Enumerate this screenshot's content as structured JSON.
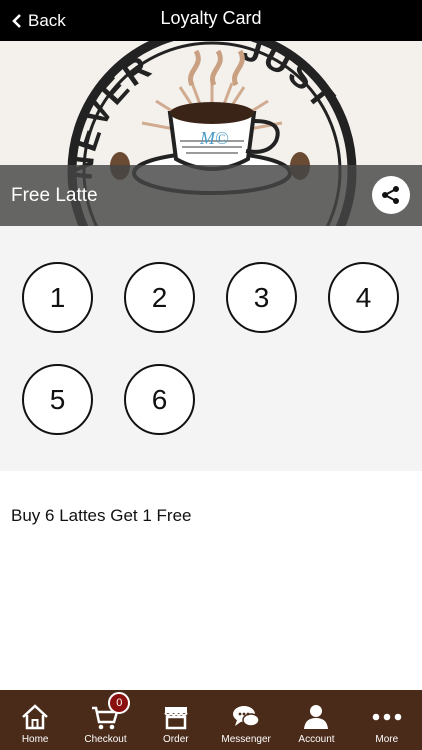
{
  "header": {
    "back_label": "Back",
    "title": "Loyalty Card"
  },
  "hero": {
    "logo_text_left": "NEVER",
    "logo_text_right": "JUST",
    "cup_mark": "M©"
  },
  "card": {
    "name": "Free Latte",
    "description": "Buy 6 Lattes Get 1 Free"
  },
  "stamps": [
    "1",
    "2",
    "3",
    "4",
    "5",
    "6"
  ],
  "tabs": [
    {
      "label": "Home",
      "icon": "home-icon"
    },
    {
      "label": "Checkout",
      "icon": "cart-icon",
      "badge": "0"
    },
    {
      "label": "Order",
      "icon": "store-icon"
    },
    {
      "label": "Messenger",
      "icon": "chat-icon"
    },
    {
      "label": "Account",
      "icon": "user-icon"
    },
    {
      "label": "More",
      "icon": "more-icon"
    }
  ],
  "colors": {
    "header_bg": "#000000",
    "tab_bar_bg": "#4a2a18",
    "badge_bg": "#8b1010",
    "stamp_area_bg": "#f4f4f4"
  }
}
